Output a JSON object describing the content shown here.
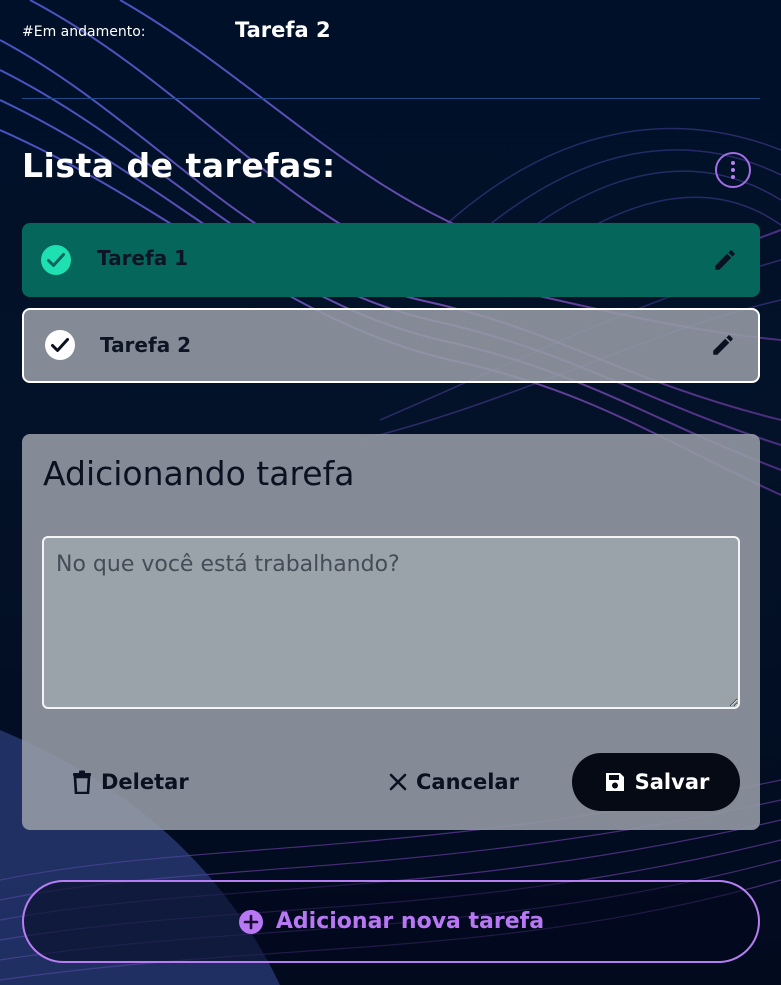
{
  "header": {
    "status_label": "#Em andamento:",
    "current_task": "Tarefa 2"
  },
  "list": {
    "title": "Lista de tarefas:",
    "menu_icon": "more-vertical-icon",
    "tasks": [
      {
        "label": "Tarefa 1",
        "completed": true,
        "color": "#05675c",
        "check_icon": "check-circle-icon",
        "edit_icon": "pencil-icon"
      },
      {
        "label": "Tarefa 2",
        "completed": false,
        "selected": true,
        "check_icon": "check-circle-icon",
        "edit_icon": "pencil-icon"
      }
    ]
  },
  "form": {
    "title": "Adicionando tarefa",
    "placeholder": "No que você está trabalhando?",
    "value": "",
    "delete_label": "Deletar",
    "delete_icon": "trash-icon",
    "cancel_label": "Cancelar",
    "cancel_icon": "close-icon",
    "save_label": "Salvar",
    "save_icon": "save-icon"
  },
  "add_button": {
    "label": "Adicionar nova tarefa",
    "icon": "plus-circle-icon"
  },
  "colors": {
    "background": "#021027",
    "accent_purple": "#b877f3",
    "task_done": "#05675c",
    "check_done": "#1fe0b0"
  }
}
